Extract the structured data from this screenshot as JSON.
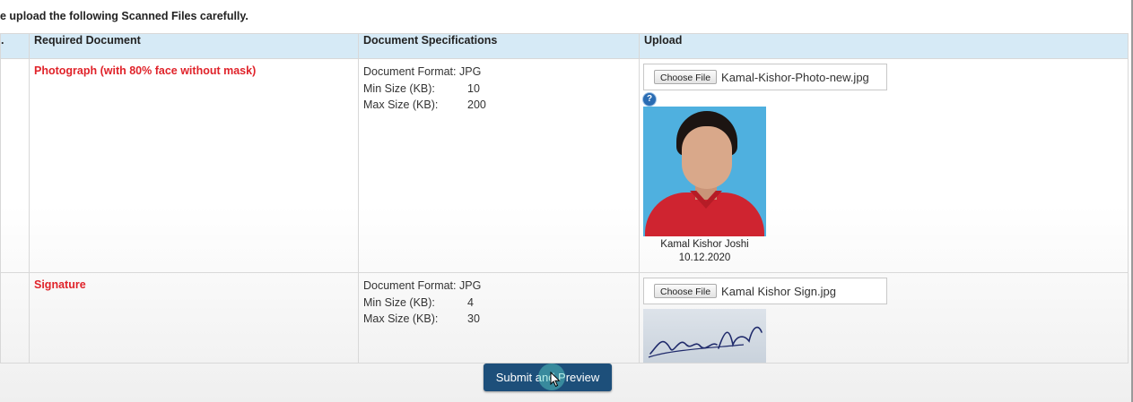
{
  "instruction": "e upload the following Scanned Files carefully.",
  "table": {
    "headers": {
      "sn": ".",
      "document": "Required Document",
      "specs": "Document Specifications",
      "upload": "Upload"
    },
    "spec_labels": {
      "format": "Document Format:",
      "min": "Min Size (KB):",
      "max": "Max Size (KB):"
    },
    "rows": [
      {
        "document": "Photograph (with 80% face without mask)",
        "format": "JPG",
        "min_kb": "10",
        "max_kb": "200",
        "choose_label": "Choose File",
        "file_name": "Kamal-Kishor-Photo-new.jpg",
        "help_icon": "?",
        "caption_name": "Kamal Kishor Joshi",
        "caption_date": "10.12.2020"
      },
      {
        "document": "Signature",
        "format": "JPG",
        "min_kb": "4",
        "max_kb": "30",
        "choose_label": "Choose File",
        "file_name": "Kamal Kishor Sign.jpg"
      }
    ]
  },
  "submit_label": "Submit and Preview",
  "colors": {
    "header_bg": "#d6eaf6",
    "doc_name": "#e0232a",
    "button": "#1d4f7a"
  },
  "icons": [
    "help-icon",
    "cursor-pointer-icon"
  ]
}
